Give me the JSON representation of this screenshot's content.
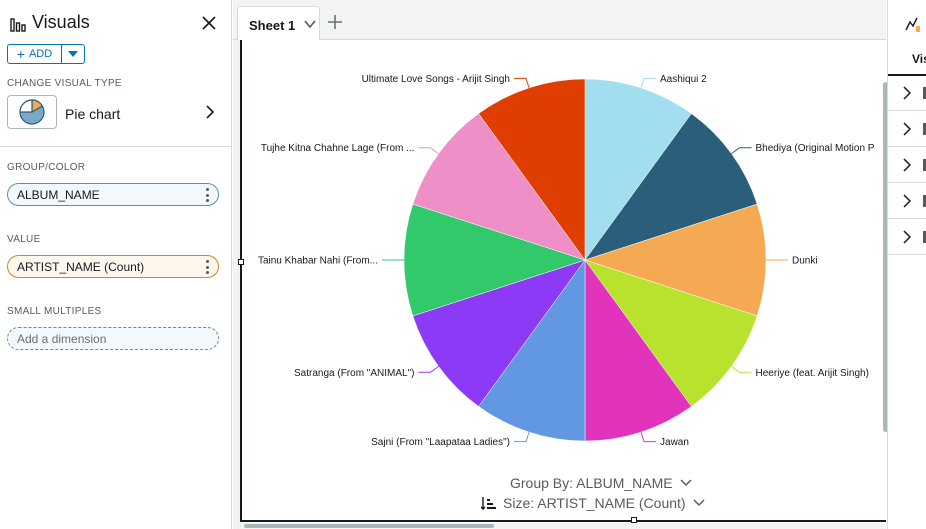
{
  "left_panel": {
    "title": "Visuals",
    "add_label": "ADD",
    "change_visual_type_label": "CHANGE VISUAL TYPE",
    "visual_type_name": "Pie chart",
    "group_color_label": "GROUP/COLOR",
    "group_color_field": "ALBUM_NAME",
    "value_label": "VALUE",
    "value_field": "ARTIST_NAME (Count)",
    "small_multiples_label": "SMALL MULTIPLES",
    "add_dimension_placeholder": "Add a dimension"
  },
  "tabs": [
    {
      "label": "Sheet 1",
      "active": true
    }
  ],
  "visual": {
    "group_by_label": "Group By: ALBUM_NAME",
    "size_label": "Size: ARTIST_NAME (Count)"
  },
  "right_panel": {
    "tab_label": "Visi"
  },
  "colors": {
    "accent": "#0073bb",
    "dimension_pill": "#5f8fa5",
    "measure_pill": "#c98b27"
  },
  "chart_data": {
    "type": "pie",
    "categories": [
      "Aashiqui 2",
      "Bhediya (Original Motion Picture Soundtrack)",
      "Dunki",
      "Heeriye (feat. Arijit Singh)",
      "Jawan",
      "Sajni (From \"Laapataa Ladies\")",
      "Satranga (From \"ANIMAL\")",
      "Tainu Khabar Nahi (From...",
      "Tujhe Kitna Chahne Lage (From ...",
      "Ultimate Love Songs - Arijit Singh"
    ],
    "display_labels": [
      "Aashiqui 2",
      "Bhediya (Original Motion P",
      "Dunki",
      "Heeriye (feat. Arijit Singh)",
      "Jawan",
      "Sajni (From \"Laapataa Ladies\")",
      "Satranga (From \"ANIMAL\")",
      "Tainu Khabar Nahi (From...",
      "Tujhe Kitna Chahne Lage (From ...",
      "Ultimate Love Songs - Arijit Singh"
    ],
    "values": [
      1,
      1,
      1,
      1,
      1,
      1,
      1,
      1,
      1,
      1
    ],
    "colors": [
      "#a3def0",
      "#2a5e7b",
      "#f4a952",
      "#b9e22e",
      "#e233bd",
      "#6198e1",
      "#8c3af5",
      "#31c96a",
      "#ee8fc8",
      "#e03e00"
    ],
    "start_angle_deg": 0,
    "direction": "clockwise",
    "legend": "none",
    "labels": "outside"
  }
}
